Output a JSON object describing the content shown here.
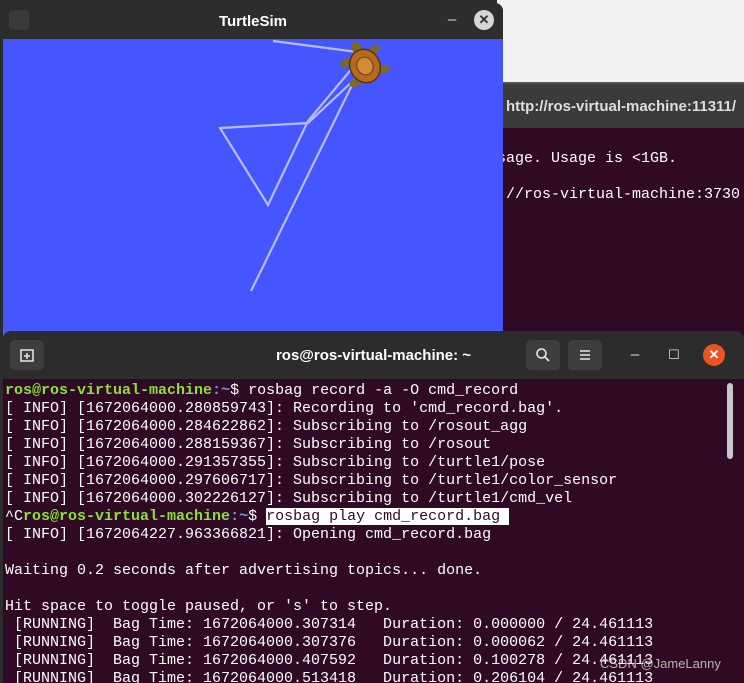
{
  "background_terminal": {
    "title": "http://ros-virtual-machine:11311/",
    "line1": "sage. Usage is <1GB.",
    "line2": "://ros-virtual-machine:3730"
  },
  "turtlesim": {
    "title": "TurtleSim",
    "minimize": "–",
    "close": "✕",
    "canvas_color": "#4556ff",
    "path_color": "#b3b8ff"
  },
  "terminal": {
    "title": "ros@ros-virtual-machine: ~",
    "new_tab_icon": "new-tab-icon",
    "search_icon": "search-icon",
    "menu_icon": "hamburger-menu-icon",
    "prompt_user": "ros@ros-virtual-machine",
    "prompt_path": ":~",
    "prompt_dollar": "$ ",
    "ctrl_c": "^C",
    "cmd1": "rosbag record -a -O cmd_record",
    "cmd2": "rosbag play cmd_record.bag ",
    "lines": [
      "[ INFO] [1672064000.280859743]: Recording to 'cmd_record.bag'.",
      "[ INFO] [1672064000.284622862]: Subscribing to /rosout_agg",
      "[ INFO] [1672064000.288159367]: Subscribing to /rosout",
      "[ INFO] [1672064000.291357355]: Subscribing to /turtle1/pose",
      "[ INFO] [1672064000.297606717]: Subscribing to /turtle1/color_sensor",
      "[ INFO] [1672064000.302226127]: Subscribing to /turtle1/cmd_vel"
    ],
    "after_lines": [
      "[ INFO] [1672064227.963366821]: Opening cmd_record.bag",
      "",
      "Waiting 0.2 seconds after advertising topics... done.",
      "",
      "Hit space to toggle paused, or 's' to step.",
      " [RUNNING]  Bag Time: 1672064000.307314   Duration: 0.000000 / 24.461113",
      " [RUNNING]  Bag Time: 1672064000.307376   Duration: 0.000062 / 24.461113",
      " [RUNNING]  Bag Time: 1672064000.407592   Duration: 0.100278 / 24.461113",
      " [RUNNING]  Bag Time: 1672064000.513418   Duration: 0.206104 / 24.461113"
    ]
  },
  "watermark": "CSDN @JameLanny"
}
